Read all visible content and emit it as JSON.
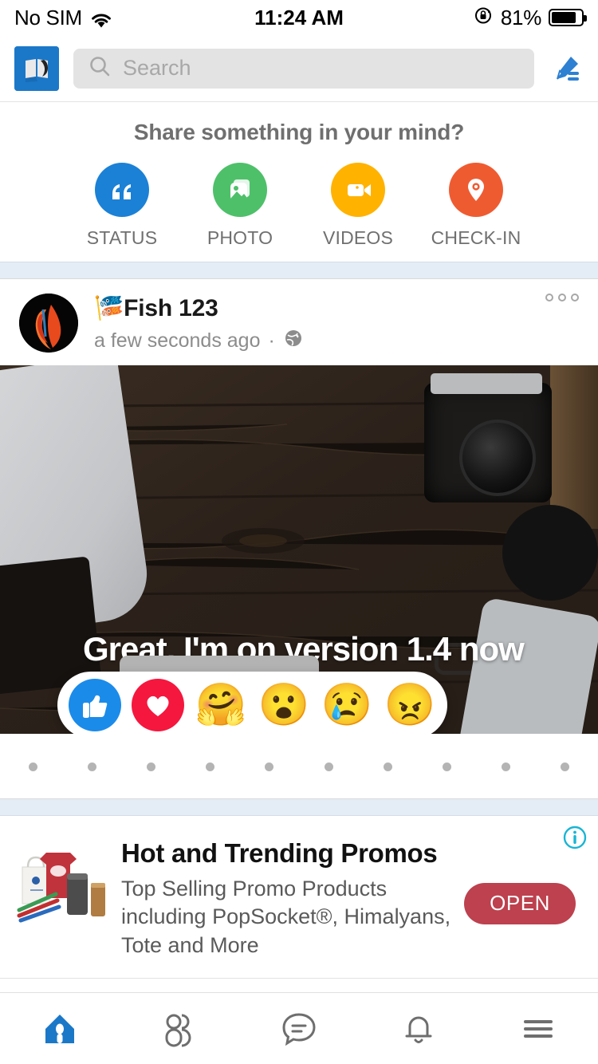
{
  "status_bar": {
    "carrier": "No SIM",
    "wifi_icon": "wifi-icon",
    "time": "11:24 AM",
    "rotation_lock_icon": "rotation-lock-icon",
    "battery_percent": "81%",
    "battery_icon": "battery-icon"
  },
  "top_bar": {
    "logo_icon": "app-logo-icon",
    "search_icon": "search-icon",
    "search_value": "",
    "search_placeholder": "Search",
    "compose_icon": "compose-pencil-icon"
  },
  "share_box": {
    "title": "Share something in your mind?",
    "items": [
      {
        "label": "STATUS",
        "icon": "quote-icon",
        "color": "#1b81d6"
      },
      {
        "label": "PHOTO",
        "icon": "photo-icon",
        "color": "#4ec06a"
      },
      {
        "label": "VIDEOS",
        "icon": "video-camera-icon",
        "color": "#ffb200"
      },
      {
        "label": "CHECK-IN",
        "icon": "location-pin-icon",
        "color": "#ef5b31"
      }
    ]
  },
  "post": {
    "avatar_icon": "avatar-betta-fish",
    "author": "🎏Fish 123",
    "timestamp": "a few seconds ago",
    "separator": "·",
    "privacy_icon": "globe-icon",
    "more_icon": "more-options-icon",
    "image_caption": "Great. I'm on version 1.4 now",
    "reactions": [
      {
        "name": "like-reaction",
        "glyph": "👍",
        "color": "#1b8bea"
      },
      {
        "name": "love-reaction",
        "glyph": "❤",
        "color": "#f5173e"
      },
      {
        "name": "care-reaction",
        "glyph": "🤗",
        "color": "#f7b125"
      },
      {
        "name": "wow-reaction",
        "glyph": "😮",
        "color": "#f7b125"
      },
      {
        "name": "sad-reaction",
        "glyph": "😢",
        "color": "#f7b125"
      },
      {
        "name": "angry-reaction",
        "glyph": "😠",
        "color": "#c0392b"
      }
    ],
    "dot_count": 10
  },
  "ad": {
    "thumb_icon": "promo-products-image",
    "title": "Hot and Trending Promos",
    "description": "Top Selling Promo Products including PopSocket®, Himalyans, Tote and More",
    "cta_label": "OPEN",
    "info_icon": "ad-info-icon",
    "cta_color": "#bd414e",
    "info_color": "#19b5d4"
  },
  "bottom_nav": {
    "active_color": "#1b78c8",
    "inactive_color": "#6e6e6e",
    "items": [
      {
        "name": "nav-home",
        "icon": "home-icon",
        "active": true
      },
      {
        "name": "nav-friends",
        "icon": "friends-icon",
        "active": false
      },
      {
        "name": "nav-messages",
        "icon": "message-bubble-icon",
        "active": false
      },
      {
        "name": "nav-notifications",
        "icon": "bell-icon",
        "active": false
      },
      {
        "name": "nav-menu",
        "icon": "hamburger-menu-icon",
        "active": false
      }
    ]
  }
}
